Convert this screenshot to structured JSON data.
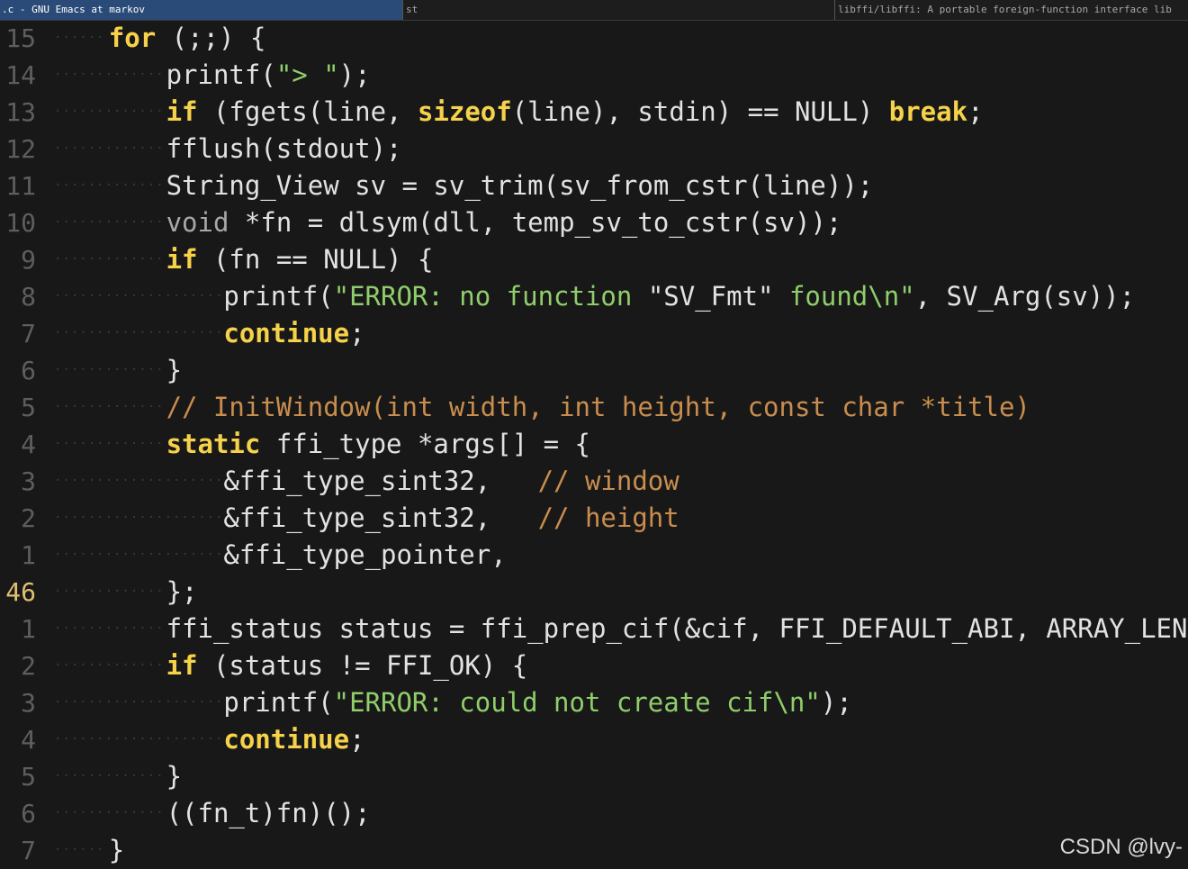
{
  "window": {
    "emacs_tab": ".c - GNU Emacs at markov",
    "st_tab": "st",
    "lib_tab": "libffi/libffi: A portable foreign-function interface lib"
  },
  "lines": [
    {
      "num": "15",
      "indent": 4,
      "tokens": [
        {
          "t": "kw",
          "v": "for"
        },
        {
          "t": "plain",
          "v": " (;;) {"
        }
      ]
    },
    {
      "num": "14",
      "indent": 8,
      "tokens": [
        {
          "t": "plain",
          "v": "printf("
        },
        {
          "t": "str",
          "v": "\"> \""
        },
        {
          "t": "plain",
          "v": ");"
        }
      ]
    },
    {
      "num": "13",
      "indent": 8,
      "tokens": [
        {
          "t": "kw",
          "v": "if"
        },
        {
          "t": "plain",
          "v": " (fgets(line, "
        },
        {
          "t": "kw",
          "v": "sizeof"
        },
        {
          "t": "plain",
          "v": "(line), stdin) == NULL) "
        },
        {
          "t": "kw",
          "v": "break"
        },
        {
          "t": "plain",
          "v": ";"
        }
      ]
    },
    {
      "num": "12",
      "indent": 8,
      "tokens": [
        {
          "t": "plain",
          "v": "fflush(stdout);"
        }
      ]
    },
    {
      "num": "11",
      "indent": 8,
      "tokens": [
        {
          "t": "plain",
          "v": "String_View sv = sv_trim(sv_from_cstr(line));"
        }
      ]
    },
    {
      "num": "10",
      "indent": 8,
      "tokens": [
        {
          "t": "type",
          "v": "void"
        },
        {
          "t": "plain",
          "v": " *fn = dlsym(dll, temp_sv_to_cstr(sv));"
        }
      ]
    },
    {
      "num": "9",
      "indent": 8,
      "tokens": [
        {
          "t": "kw",
          "v": "if"
        },
        {
          "t": "plain",
          "v": " (fn == NULL) {"
        }
      ]
    },
    {
      "num": "8",
      "indent": 12,
      "tokens": [
        {
          "t": "plain",
          "v": "printf("
        },
        {
          "t": "str",
          "v": "\"ERROR: no function "
        },
        {
          "t": "plain",
          "v": "\"SV_Fmt\""
        },
        {
          "t": "str",
          "v": " found\\n\""
        },
        {
          "t": "plain",
          "v": ", SV_Arg(sv));"
        }
      ]
    },
    {
      "num": "7",
      "indent": 12,
      "tokens": [
        {
          "t": "kw",
          "v": "continue"
        },
        {
          "t": "plain",
          "v": ";"
        }
      ]
    },
    {
      "num": "6",
      "indent": 8,
      "tokens": [
        {
          "t": "plain",
          "v": "}"
        }
      ]
    },
    {
      "num": "5",
      "indent": 8,
      "tokens": [
        {
          "t": "cmt",
          "v": "// InitWindow(int width, int height, const char *title)"
        }
      ]
    },
    {
      "num": "4",
      "indent": 8,
      "tokens": [
        {
          "t": "kw",
          "v": "static"
        },
        {
          "t": "plain",
          "v": " ffi_type *args[] = {"
        }
      ]
    },
    {
      "num": "3",
      "indent": 12,
      "tokens": [
        {
          "t": "plain",
          "v": "&ffi_type_sint32,   "
        },
        {
          "t": "cmt",
          "v": "// window"
        }
      ]
    },
    {
      "num": "2",
      "indent": 12,
      "tokens": [
        {
          "t": "plain",
          "v": "&ffi_type_sint32,   "
        },
        {
          "t": "cmt",
          "v": "// height"
        }
      ]
    },
    {
      "num": "1",
      "indent": 12,
      "tokens": [
        {
          "t": "plain",
          "v": "&ffi_type_pointer,"
        }
      ]
    },
    {
      "num": "46",
      "indent": 8,
      "current": true,
      "tokens": [
        {
          "t": "plain",
          "v": "};"
        }
      ]
    },
    {
      "num": "1",
      "indent": 8,
      "tokens": [
        {
          "t": "plain",
          "v": "ffi_status status = ffi_prep_cif(&cif, FFI_DEFAULT_ABI, ARRAY_LEN(args)"
        }
      ]
    },
    {
      "num": "2",
      "indent": 8,
      "tokens": [
        {
          "t": "kw",
          "v": "if"
        },
        {
          "t": "plain",
          "v": " (status != FFI_OK) {"
        }
      ]
    },
    {
      "num": "3",
      "indent": 12,
      "tokens": [
        {
          "t": "plain",
          "v": "printf("
        },
        {
          "t": "str",
          "v": "\"ERROR: could not create cif\\n\""
        },
        {
          "t": "plain",
          "v": ");"
        }
      ]
    },
    {
      "num": "4",
      "indent": 12,
      "tokens": [
        {
          "t": "kw",
          "v": "continue"
        },
        {
          "t": "plain",
          "v": ";"
        }
      ]
    },
    {
      "num": "5",
      "indent": 8,
      "tokens": [
        {
          "t": "plain",
          "v": "}"
        }
      ]
    },
    {
      "num": "6",
      "indent": 8,
      "tokens": [
        {
          "t": "plain",
          "v": "((fn_t)fn)();"
        }
      ]
    },
    {
      "num": "7",
      "indent": 4,
      "tokens": [
        {
          "t": "plain",
          "v": "}"
        }
      ]
    }
  ],
  "watermark": "CSDN @lvy-"
}
